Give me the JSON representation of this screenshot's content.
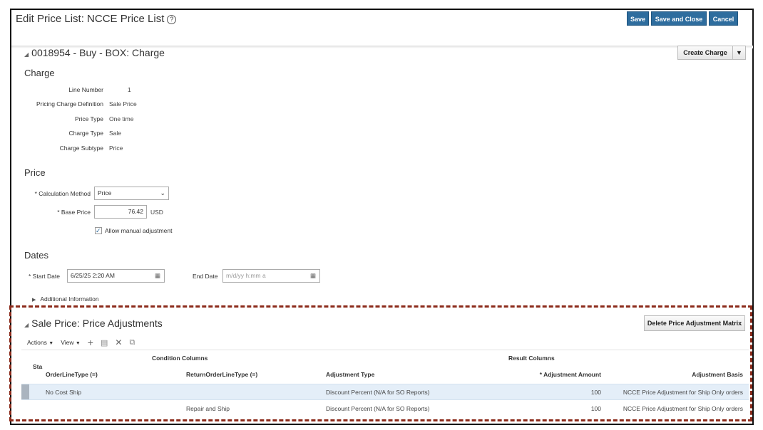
{
  "header": {
    "title": "Edit Price List: NCCE Price List",
    "help": "?",
    "save": "Save",
    "save_close": "Save and Close",
    "cancel": "Cancel"
  },
  "charge_section": {
    "title": "0018954 - Buy - BOX: Charge",
    "create_charge": "Create Charge",
    "charge": {
      "heading": "Charge",
      "fields": [
        {
          "label": "Line Number",
          "value": "1"
        },
        {
          "label": "Pricing Charge Definition",
          "value": "Sale Price"
        },
        {
          "label": "Price Type",
          "value": "One time"
        },
        {
          "label": "Charge Type",
          "value": "Sale"
        },
        {
          "label": "Charge Subtype",
          "value": "Price"
        }
      ]
    },
    "price": {
      "heading": "Price",
      "calc_label": "Calculation Method",
      "calc_value": "Price",
      "base_label": "Base Price",
      "base_value": "76.42",
      "currency": "USD",
      "allow_manual": "Allow manual adjustment",
      "allow_manual_checked": true
    },
    "dates": {
      "heading": "Dates",
      "start_label": "Start Date",
      "start_value": "6/25/25 2:20 AM",
      "end_label": "End Date",
      "end_placeholder": "m/d/yy h:mm a"
    },
    "additional": "Additional Information"
  },
  "adjustments": {
    "title": "Sale Price: Price Adjustments",
    "delete_matrix": "Delete Price Adjustment Matrix",
    "actions": "Actions",
    "view": "View",
    "group_condition": "Condition Columns",
    "group_result": "Result Columns",
    "status_col": "Sta",
    "columns": [
      "OrderLineType (=)",
      "ReturnOrderLineType (=)",
      "Adjustment Type",
      "Adjustment Amount",
      "Adjustment Basis"
    ],
    "rows": [
      {
        "order_line_type": "No Cost Ship",
        "return_order_line_type": "",
        "adjustment_type": "Discount Percent (N/A for SO Reports)",
        "amount": "100",
        "basis": "NCCE Price Adjustment for Ship Only orders"
      },
      {
        "order_line_type": "",
        "return_order_line_type": "Repair and Ship",
        "adjustment_type": "Discount Percent (N/A for SO Reports)",
        "amount": "100",
        "basis": "NCCE Price Adjustment for Ship Only orders"
      }
    ]
  }
}
